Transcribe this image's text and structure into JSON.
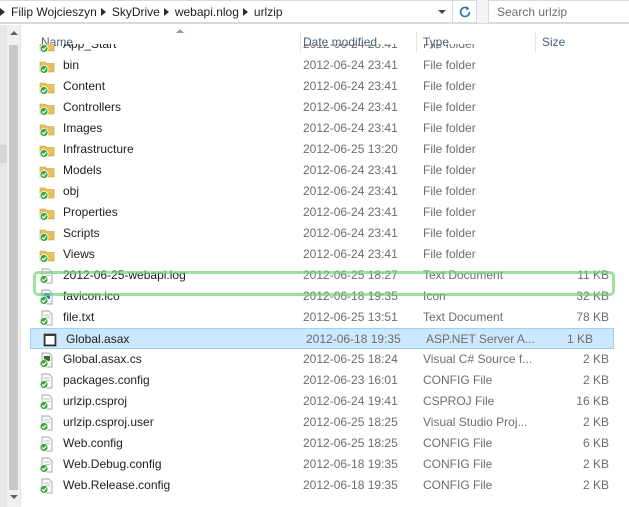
{
  "address_bar": {
    "breadcrumbs": [
      "Filip Wojcieszyn",
      "SkyDrive",
      "webapi.nlog",
      "urlzip"
    ]
  },
  "search": {
    "placeholder": "Search urlzip"
  },
  "columns": {
    "name": "Name",
    "date_modified": "Date modified",
    "type": "Type",
    "size": "Size"
  },
  "files": [
    {
      "name": "App_Start",
      "date": "2012-06-24 23:41",
      "type": "File folder",
      "size": "",
      "icon": "folder-sync-icon"
    },
    {
      "name": "bin",
      "date": "2012-06-24 23:41",
      "type": "File folder",
      "size": "",
      "icon": "folder-sync-icon"
    },
    {
      "name": "Content",
      "date": "2012-06-24 23:41",
      "type": "File folder",
      "size": "",
      "icon": "folder-sync-icon"
    },
    {
      "name": "Controllers",
      "date": "2012-06-24 23:41",
      "type": "File folder",
      "size": "",
      "icon": "folder-sync-icon"
    },
    {
      "name": "Images",
      "date": "2012-06-24 23:41",
      "type": "File folder",
      "size": "",
      "icon": "folder-sync-icon"
    },
    {
      "name": "Infrastructure",
      "date": "2012-06-25 13:20",
      "type": "File folder",
      "size": "",
      "icon": "folder-sync-icon"
    },
    {
      "name": "Models",
      "date": "2012-06-24 23:41",
      "type": "File folder",
      "size": "",
      "icon": "folder-sync-icon"
    },
    {
      "name": "obj",
      "date": "2012-06-24 23:41",
      "type": "File folder",
      "size": "",
      "icon": "folder-sync-icon"
    },
    {
      "name": "Properties",
      "date": "2012-06-24 23:41",
      "type": "File folder",
      "size": "",
      "icon": "folder-sync-icon"
    },
    {
      "name": "Scripts",
      "date": "2012-06-24 23:41",
      "type": "File folder",
      "size": "",
      "icon": "folder-sync-icon"
    },
    {
      "name": "Views",
      "date": "2012-06-24 23:41",
      "type": "File folder",
      "size": "",
      "icon": "folder-sync-icon"
    },
    {
      "name": "2012-06-25-webapi.log",
      "date": "2012-06-25 18:27",
      "type": "Text Document",
      "size": "11 KB",
      "icon": "text-file-sync-icon"
    },
    {
      "name": "favicon.ico",
      "date": "2012-06-18 19:35",
      "type": "Icon",
      "size": "32 KB",
      "icon": "ico-file-sync-icon"
    },
    {
      "name": "file.txt",
      "date": "2012-06-25 13:51",
      "type": "Text Document",
      "size": "78 KB",
      "icon": "text-file-sync-icon"
    },
    {
      "name": "Global.asax",
      "date": "2012-06-18 19:35",
      "type": "ASP.NET Server A...",
      "size": "1 KB",
      "icon": "asax-file-icon"
    },
    {
      "name": "Global.asax.cs",
      "date": "2012-06-25 18:24",
      "type": "Visual C# Source f...",
      "size": "2 KB",
      "icon": "cs-file-sync-icon"
    },
    {
      "name": "packages.config",
      "date": "2012-06-23 16:01",
      "type": "CONFIG File",
      "size": "2 KB",
      "icon": "config-file-sync-icon"
    },
    {
      "name": "urlzip.csproj",
      "date": "2012-06-24 19:41",
      "type": "CSPROJ File",
      "size": "16 KB",
      "icon": "csproj-file-sync-icon"
    },
    {
      "name": "urlzip.csproj.user",
      "date": "2012-06-25 18:25",
      "type": "Visual Studio Proj...",
      "size": "2 KB",
      "icon": "user-file-sync-icon"
    },
    {
      "name": "Web.config",
      "date": "2012-06-25 18:25",
      "type": "CONFIG File",
      "size": "6 KB",
      "icon": "config-file-sync-icon"
    },
    {
      "name": "Web.Debug.config",
      "date": "2012-06-18 19:35",
      "type": "CONFIG File",
      "size": "2 KB",
      "icon": "config-file-sync-icon"
    },
    {
      "name": "Web.Release.config",
      "date": "2012-06-18 19:35",
      "type": "CONFIG File",
      "size": "2 KB",
      "icon": "config-file-sync-icon"
    }
  ],
  "selected_file": "Global.asax",
  "highlighted_file": "2012-06-25-webapi.log",
  "colors": {
    "selection": "#cce8ff",
    "highlight_ring": "#6bcf6b",
    "sync_badge": "#3aa63a",
    "folder": "#e8c15a"
  }
}
